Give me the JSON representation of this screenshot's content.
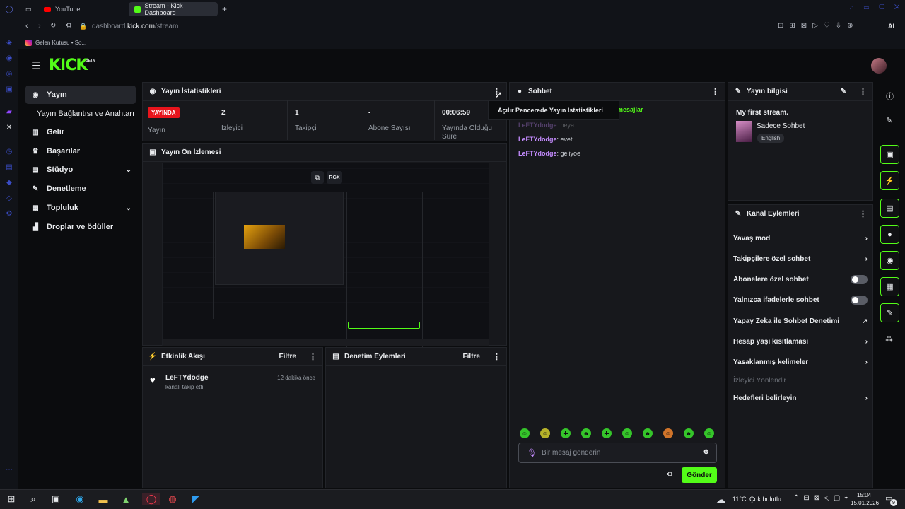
{
  "browser": {
    "tabs": [
      {
        "label": "YouTube"
      },
      {
        "label": "Stream - Kick Dashboard"
      }
    ],
    "address": {
      "domain_pre": "dashboard.",
      "domain_main": "kick.com",
      "path": "/stream"
    },
    "bookmark": "Gelen Kutusu • So...",
    "ai_label": "AI"
  },
  "kick": {
    "logo": "KICK",
    "logo_badge": "BETA",
    "sidebar": {
      "items": [
        {
          "label": "Yayın",
          "icon": "broadcast-icon"
        },
        {
          "label": "Yayın Bağlantısı ve Anahtarı",
          "icon": ""
        },
        {
          "label": "Gelir",
          "icon": "chart-icon"
        },
        {
          "label": "Başarılar",
          "icon": "trophy-icon"
        },
        {
          "label": "Stüdyo",
          "icon": "studio-icon"
        },
        {
          "label": "Denetleme",
          "icon": "wrench-icon"
        },
        {
          "label": "Topluluk",
          "icon": "users-icon"
        },
        {
          "label": "Droplar ve ödüller",
          "icon": "gift-icon"
        }
      ]
    },
    "stats_panel": {
      "title": "Yayın İstatistikleri",
      "live_badge": "YAYINDA",
      "live_label": "Yayın",
      "stats": [
        {
          "value": "2",
          "label": "İzleyici"
        },
        {
          "value": "1",
          "label": "Takipçi"
        },
        {
          "value": "-",
          "label": "Abone Sayısı"
        },
        {
          "value": "00:06:59",
          "label": "Yayında Olduğu Süre"
        }
      ],
      "menu_tooltip": "Açılır Pencerede Yayın İstatistikleri"
    },
    "preview": {
      "title": "Yayın Ön İzlemesi",
      "badge": "RGX"
    },
    "activity": {
      "title": "Etkinlik Akışı",
      "filter": "Filtre",
      "items": [
        {
          "user": "LeFTYdodge",
          "text": "kanalı takip etti",
          "time": "12 dakika önce"
        }
      ]
    },
    "moderation": {
      "title": "Denetim Eylemleri",
      "filter": "Filtre"
    },
    "chat": {
      "title": "Sohbet",
      "new_messages": "mesajlar",
      "messages": [
        {
          "user": "LeFTYdodge",
          "text": "heya"
        },
        {
          "user": "LeFTYdodge",
          "text": "evet"
        },
        {
          "user": "LeFTYdodge",
          "text": "geliyoe"
        }
      ],
      "placeholder": "Bir mesaj gönderin",
      "send": "Gönder"
    },
    "stream_info": {
      "title": "Yayın bilgisi",
      "stream_title": "My first stream.",
      "category": "Sadece Sohbet",
      "language": "English"
    },
    "channel_actions": {
      "title": "Kanal Eylemleri",
      "items": [
        {
          "label": "Yavaş mod",
          "kind": "chevron"
        },
        {
          "label": "Takipçilere özel sohbet",
          "kind": "chevron"
        },
        {
          "label": "Abonelere özel sohbet",
          "kind": "toggle"
        },
        {
          "label": "Yalnızca ifadelerle sohbet",
          "kind": "toggle"
        },
        {
          "label": "Yapay Zeka ile Sohbet Denetimi",
          "kind": "external"
        },
        {
          "label": "Hesap yaşı kısıtlaması",
          "kind": "chevron"
        },
        {
          "label": "Yasaklanmış kelimeler",
          "kind": "chevron"
        },
        {
          "label": "İzleyici Yönlendir",
          "kind": "disabled"
        },
        {
          "label": "Hedefleri belirleyin",
          "kind": "chevron"
        }
      ]
    },
    "colors": {
      "brand": "#53fc18",
      "live": "#e8141c",
      "username": "#c58cff"
    }
  },
  "taskbar": {
    "weather_temp": "11°C",
    "weather_text": "Çok bulutlu",
    "time": "15:04",
    "date": "15.01.2026",
    "notifications": "9"
  }
}
